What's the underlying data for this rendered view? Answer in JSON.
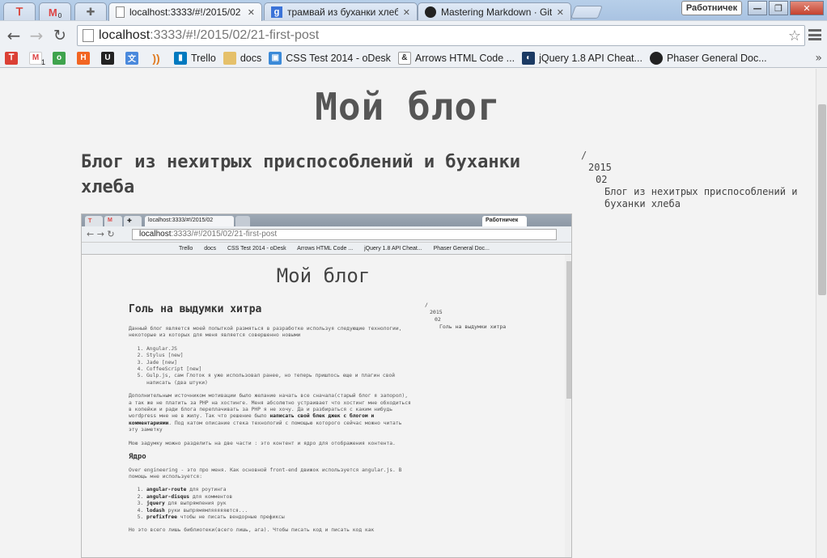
{
  "browser": {
    "tabs": [
      {
        "title": "",
        "icon": "todoist-icon",
        "pinned": true
      },
      {
        "title": "0",
        "icon": "gmail-icon",
        "pinned": true
      },
      {
        "title": "",
        "icon": "puzzle-icon",
        "pinned": true
      },
      {
        "title": "localhost:3333/#!/2015/02",
        "icon": "page-icon",
        "active": true
      },
      {
        "title": "трамвай из буханки хлеба",
        "icon": "google-icon"
      },
      {
        "title": "Mastering Markdown · Git",
        "icon": "github-icon"
      }
    ],
    "profile_name": "Работничек",
    "url_host": "localhost",
    "url_path": ":3333/#!/2015/02/21-first-post",
    "bookmarks": [
      {
        "label": "",
        "icon": "todoist-icon",
        "color": "#db4035"
      },
      {
        "label": "",
        "icon": "gmail-icon",
        "color": "#d44",
        "badge": "1"
      },
      {
        "label": "",
        "icon": "odnoklassniki-icon",
        "color": "#3fa34d"
      },
      {
        "label": "",
        "icon": "hackernews-icon",
        "color": "#f26522"
      },
      {
        "label": "",
        "icon": "unsplash-icon",
        "color": "#222"
      },
      {
        "label": "",
        "icon": "translate-icon",
        "color": "#4a89dc"
      },
      {
        "label": "",
        "icon": "rss-icon",
        "color": "#e07b22"
      },
      {
        "label": "Trello",
        "icon": "trello-icon",
        "color": "#0079bf"
      },
      {
        "label": "docs",
        "icon": "folder-icon",
        "color": "#e5c06a"
      },
      {
        "label": "CSS Test 2014 - oDesk",
        "icon": "odesk-icon",
        "color": "#3b8ad8"
      },
      {
        "label": "Arrows HTML Code ...",
        "icon": "arrows-icon",
        "color": "#333"
      },
      {
        "label": "jQuery 1.8 API Cheat...",
        "icon": "jquery-icon",
        "color": "#1b3a63"
      },
      {
        "label": "Phaser General Doc...",
        "icon": "github-icon",
        "color": "#222"
      }
    ]
  },
  "page": {
    "blog_title": "Мой блог",
    "post_title": "Блог из нехитрых приспособлений и буханки хлеба",
    "toc": {
      "root": "/",
      "year": "2015",
      "month": "02",
      "post": "Блог из нехитрых приспособлений и буханки хлеба"
    }
  },
  "embedded_screenshot": {
    "tab_title": "localhost:3333/#!/2015/02",
    "profile_name": "Работничек",
    "url_host": "localhost",
    "url_path": ":3333/#!/2015/02/21-first-post",
    "bookmarks": [
      "Trello",
      "docs",
      "CSS Test 2014 - oDesk",
      "Arrows HTML Code ...",
      "jQuery 1.8 API Cheat...",
      "Phaser General Doc..."
    ],
    "blog_title": "Мой блог",
    "post_title": "Голь на выдумки хитра",
    "toc": {
      "root": "/",
      "year": "2015",
      "month": "02",
      "post": "Голь на выдумки хитра"
    },
    "intro": "Данный блог является моей попыткой размяться в разработке используя следующие технологии, некоторые из которых для меня является совершенно новыми",
    "tech_list": [
      "Angular.JS",
      "Stylus [new]",
      "Jade [new]",
      "CoffeeScript [new]",
      "Gulp.js, сам Глоток я уже использовал ранее, но теперь пришлось еще и плагин свой написать (два штуки)"
    ],
    "para2_start": "Дополнительным источником мотивации было желание начать все сначала(старый блог я запорол), а так же не платить за PHP на хостинге. Меня абсолютно устраивает что хостинг мне обходиться в копейки и ради блога переплачивать за PHP я не хочу. Да и разбираться с каким нибудь wordpress мне не в жилу. Так что решение было ",
    "para2_bold": "написать свой блек джек с блогом и комментариями",
    "para2_end": ". Под катом описание стека технологий с помощью которого сейчас можно читать эту заметку",
    "para3": "Мою задумку можно разделить на две части : это контент и ядро для отображения контента.",
    "core_heading": "Ядро",
    "core_intro": "Over engineering - это про меня. Как основной front-end движок используется angular.js. В помощь мне используется:",
    "core_list": [
      {
        "name": "angular-route",
        "desc": " для роутинга"
      },
      {
        "name": "angular-disqus",
        "desc": " для комментов"
      },
      {
        "name": "jquery",
        "desc": " для выпрямления рук"
      },
      {
        "name": "lodash",
        "desc": " руки выпрямямляяяяяются..."
      },
      {
        "name": "prefixfree",
        "desc": " чтобы не писать вендорные префиксы"
      }
    ],
    "outro": "Но это всего лишь библиотеки(всего лишь, ага). Чтобы писать код и писать код как"
  }
}
